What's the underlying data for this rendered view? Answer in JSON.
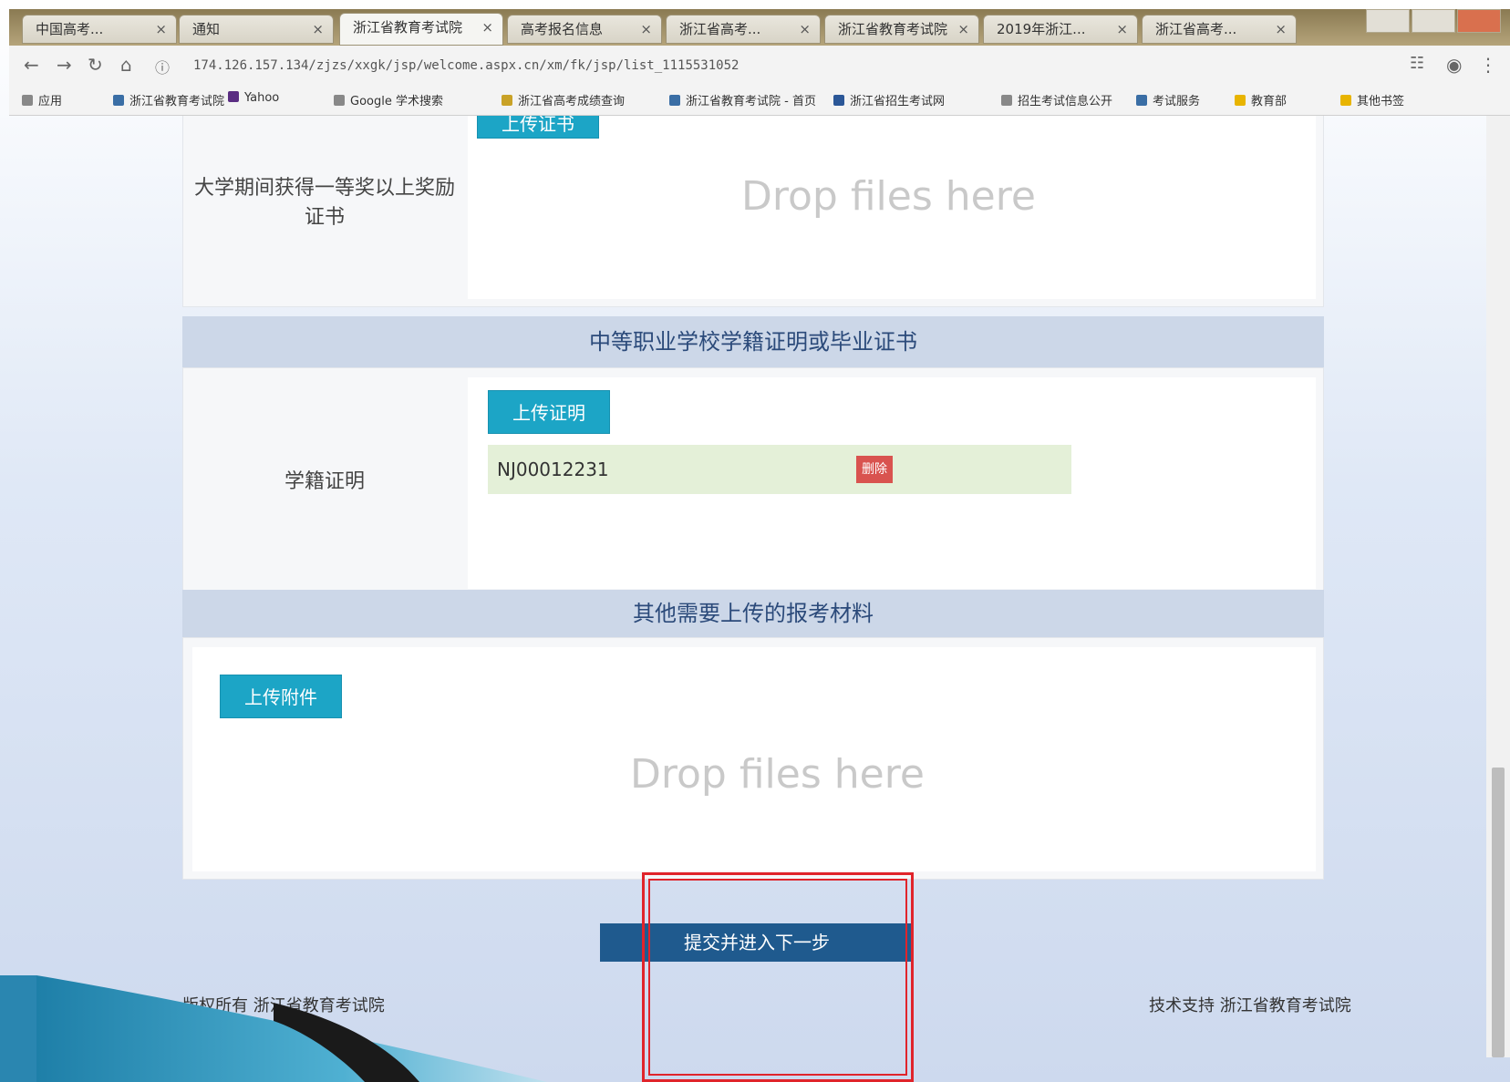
{
  "browser": {
    "tabs": [
      {
        "label": "中国高考...",
        "active": false
      },
      {
        "label": "通知",
        "active": false
      },
      {
        "label": "浙江省教育考试院",
        "active": true
      },
      {
        "label": "高考报名信息",
        "active": false
      },
      {
        "label": "浙江省高考...",
        "active": false
      },
      {
        "label": "浙江省教育考试院",
        "active": false
      },
      {
        "label": "2019年浙江...",
        "active": false
      },
      {
        "label": "浙江省高考...",
        "active": false
      }
    ],
    "url": "174.126.157.134/zjzs/xxgk/jsp/welcome.aspx.cn/xm/fk/jsp/list_1115531052",
    "bookmarks": [
      "应用",
      "浙江省教育考试院",
      "Yahoo",
      "Google 学术搜索",
      "浙江省高考成绩查询",
      "浙江省教育考试院 - 首页",
      "浙江省招生考试网",
      "招生考试信息公开",
      "考试服务",
      "教育部",
      "其他书签"
    ],
    "bookmark_colors": [
      "#888888",
      "#3a6ea5",
      "#5a2d82",
      "#888888",
      "#c9a227",
      "#3a6ea5",
      "#2b5797",
      "#888888",
      "#3a6ea5",
      "#e8b400",
      "#e8b400"
    ]
  },
  "page": {
    "section1": {
      "row_label": "大学期间获得一等奖以上奖励证书",
      "upload_label": "上传证书",
      "drop_text": "Drop files here"
    },
    "section2": {
      "header": "中等职业学校学籍证明或毕业证书",
      "row_label": "学籍证明",
      "upload_label": "上传证明",
      "file_name": "NJ00012231",
      "delete_label": "删除"
    },
    "section3": {
      "header": "其他需要上传的报考材料",
      "upload_label": "上传附件",
      "drop_text": "Drop files here"
    },
    "submit_label": "提交并进入下一步",
    "footer_left": "版权所有 浙江省教育考试院",
    "footer_right": "技术支持 浙江省教育考试院"
  }
}
